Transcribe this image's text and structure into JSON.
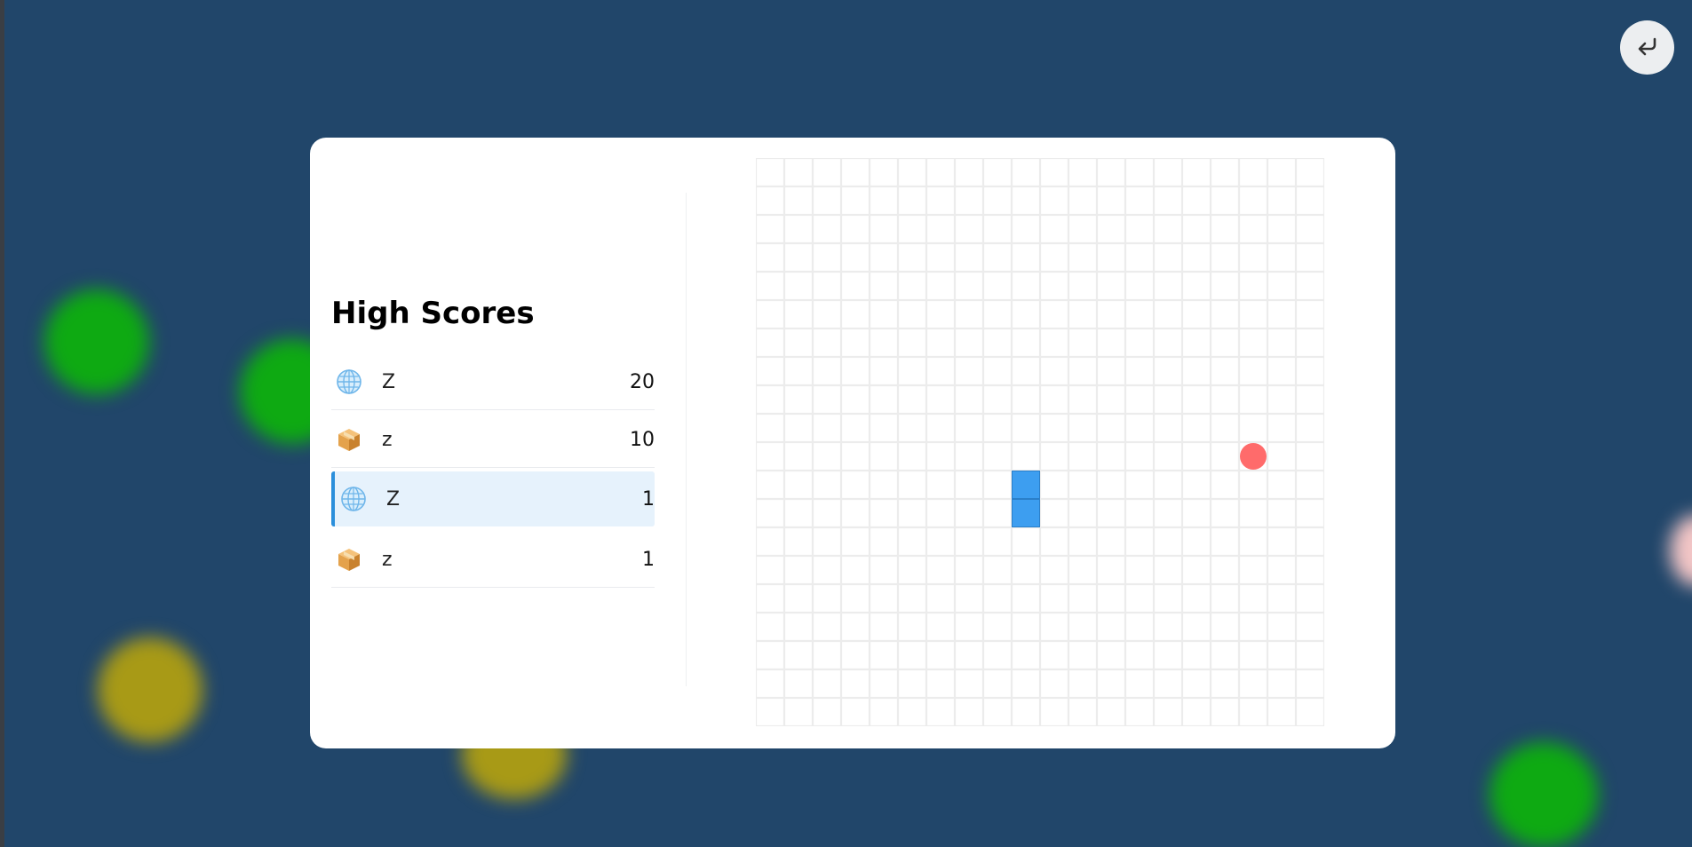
{
  "background": {
    "color": "#21466a"
  },
  "back_button": {
    "icon": "return-arrow-icon"
  },
  "high_scores": {
    "title": "High Scores",
    "entries": [
      {
        "icon": "globe-icon",
        "name": "Z",
        "score": "20",
        "current": false
      },
      {
        "icon": "package-icon",
        "name": "z",
        "score": "10",
        "current": false
      },
      {
        "icon": "globe-icon",
        "name": "Z",
        "score": "1",
        "current": true
      },
      {
        "icon": "package-icon",
        "name": "z",
        "score": "1",
        "current": false
      }
    ]
  },
  "game_board": {
    "columns": 20,
    "rows": 20,
    "snake": [
      [
        9,
        11
      ],
      [
        9,
        12
      ]
    ],
    "food": [
      17,
      10
    ],
    "colors": {
      "grid_line": "#ececec",
      "snake": "#3d9ef0",
      "snake_border": "#2a7fc9",
      "food": "#ff6b6b",
      "highlight_accent": "#2b8fdb"
    }
  }
}
